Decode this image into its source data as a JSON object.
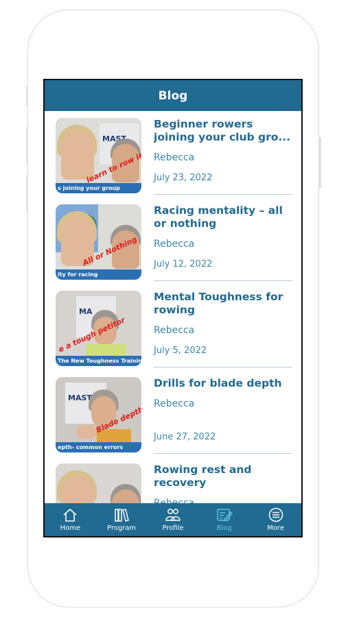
{
  "header": {
    "title": "Blog"
  },
  "posts": [
    {
      "title": "Beginner rowers joining your club gro...",
      "author": "Rebecca",
      "date": "July 23, 2022",
      "thumb_caption": "s joining your group",
      "thumb_scribble": "learn to row is FUN",
      "bg": "#d9d9d6"
    },
    {
      "title": "Racing mentality – all or nothing",
      "author": "Rebecca",
      "date": "July 12, 2022",
      "thumb_caption": "ity for racing",
      "thumb_scribble": "All or Nothing",
      "bg": "#6f9ccf"
    },
    {
      "title": "Mental Toughness for rowing",
      "author": "Rebecca",
      "date": "July 5, 2022",
      "thumb_caption": "The New Toughness Training for Sports",
      "thumb_scribble": "e a tough petitor",
      "bg": "#d3d0cc"
    },
    {
      "title": "Drills for blade depth",
      "author": "Rebecca",
      "date": "June 27, 2022",
      "thumb_caption": "epth- common errors",
      "thumb_scribble": "Blade depth",
      "bg": "#cbc7c2"
    },
    {
      "title": "Rowing rest and recovery",
      "author": "Rebecca",
      "date": "",
      "thumb_caption": "",
      "thumb_scribble": "",
      "bg": "#d6d4d0"
    }
  ],
  "tabs": [
    {
      "label": "Home",
      "icon": "home-icon"
    },
    {
      "label": "Program",
      "icon": "books-icon"
    },
    {
      "label": "Profile",
      "icon": "people-icon"
    },
    {
      "label": "Blog",
      "icon": "blog-edit-icon",
      "active": true
    },
    {
      "label": "More",
      "icon": "menu-circle-icon"
    }
  ],
  "colors": {
    "brand": "#216a91",
    "active_tab": "#5fc4e6",
    "text": "#3a86a6"
  }
}
